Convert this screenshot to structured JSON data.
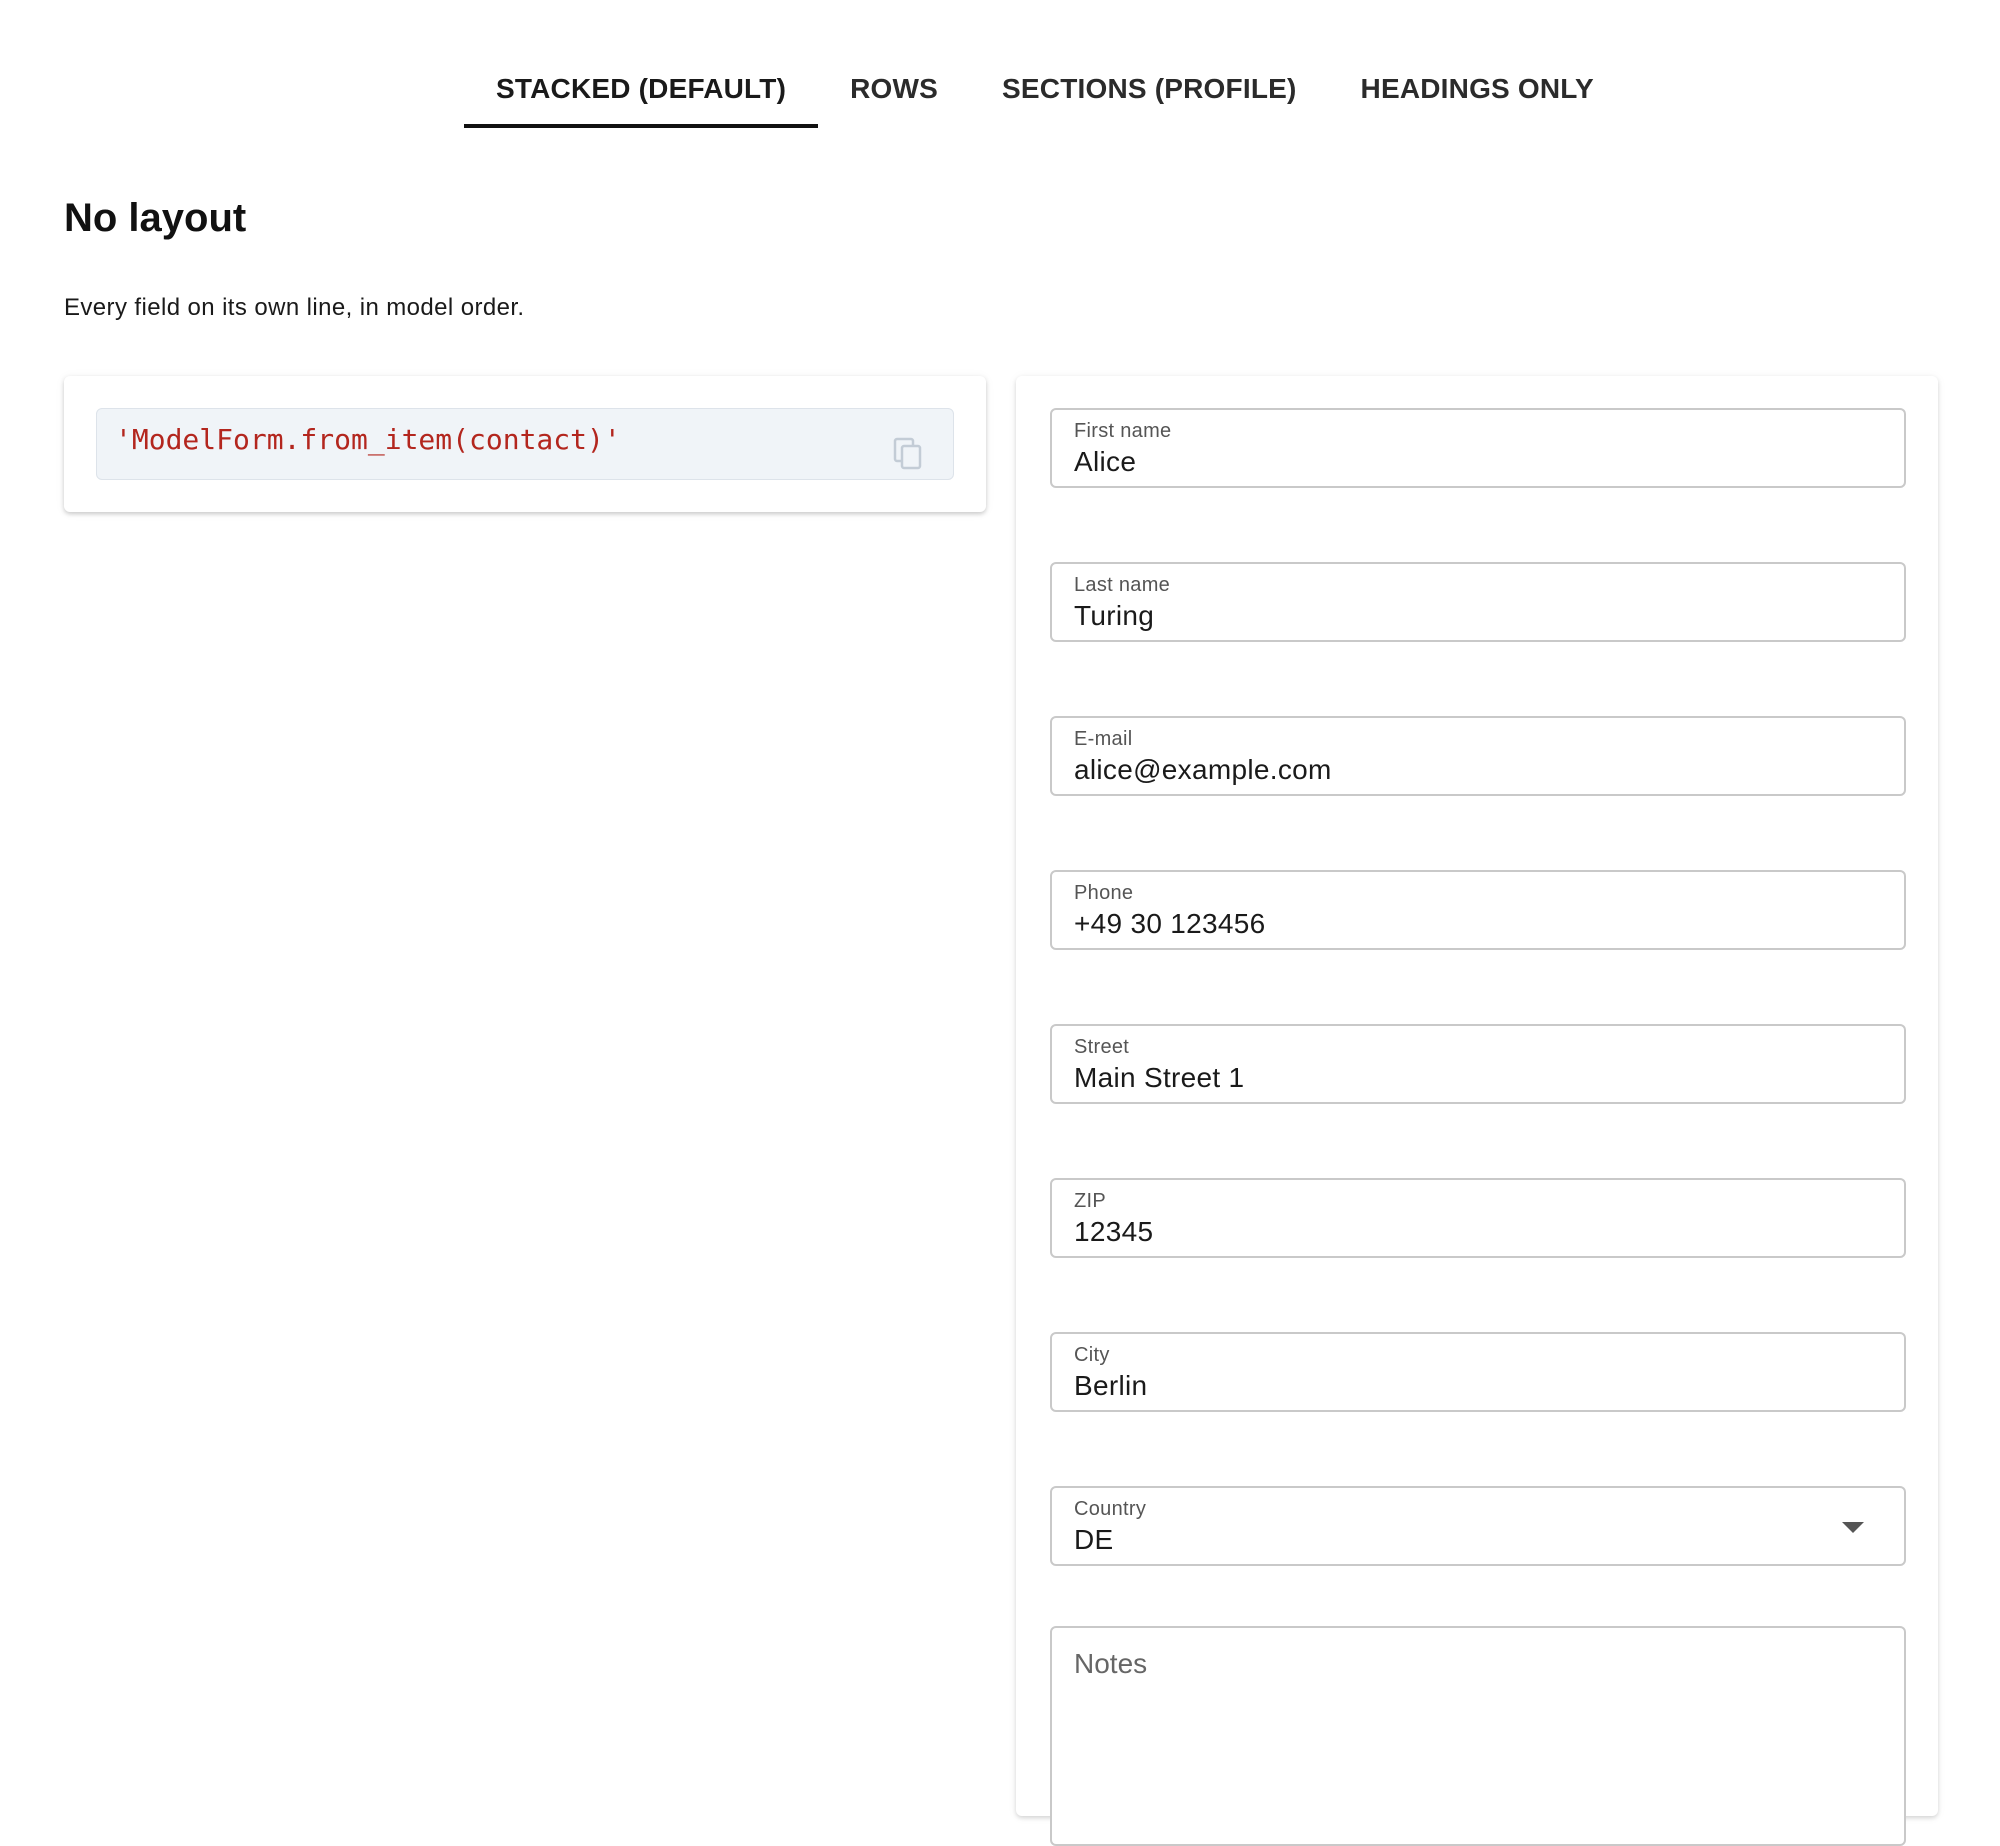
{
  "tabs": [
    {
      "label": "STACKED (DEFAULT)",
      "active": true
    },
    {
      "label": "ROWS",
      "active": false
    },
    {
      "label": "SECTIONS (PROFILE)",
      "active": false
    },
    {
      "label": "HEADINGS ONLY",
      "active": false
    }
  ],
  "header": {
    "title": "No layout",
    "subtitle": "Every field on its own line, in model order."
  },
  "code": {
    "snippet": "'ModelForm.from_item(contact)'",
    "copy_icon": "copy-icon"
  },
  "form": {
    "fields": [
      {
        "label": "First name",
        "value": "Alice"
      },
      {
        "label": "Last name",
        "value": "Turing"
      },
      {
        "label": "E-mail",
        "value": "alice@example.com"
      },
      {
        "label": "Phone",
        "value": "+49 30 123456"
      },
      {
        "label": "Street",
        "value": "Main Street 1"
      },
      {
        "label": "ZIP",
        "value": "12345"
      },
      {
        "label": "City",
        "value": "Berlin"
      },
      {
        "label": "Country",
        "value": "DE"
      }
    ],
    "notes_placeholder": "Notes"
  },
  "colors": {
    "code_text": "#b3261e",
    "code_background": "#f0f4f8",
    "tab_indicator": "#111111",
    "field_border": "#c9c9c9"
  }
}
